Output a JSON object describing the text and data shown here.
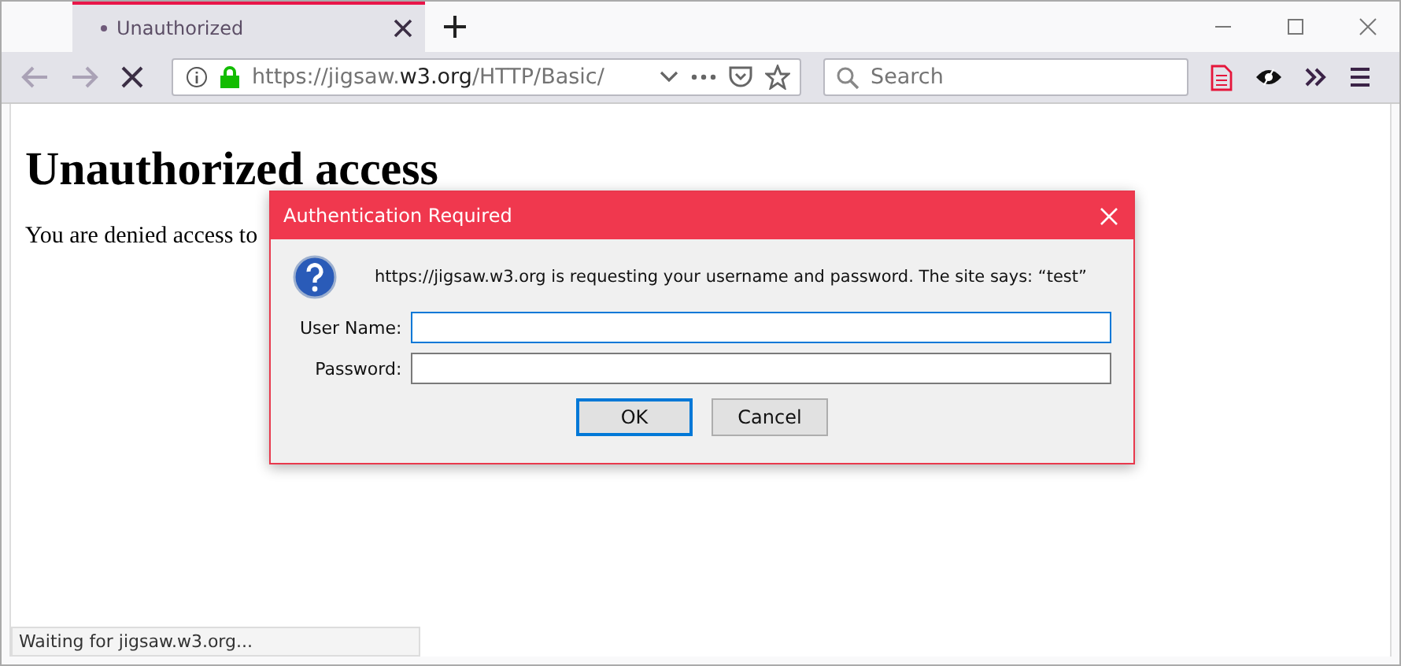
{
  "tabs": [
    {
      "title": "Unauthorized",
      "selected": true
    }
  ],
  "address_bar": {
    "url_prefix": "https://jigsaw.",
    "url_domain": "w3.org",
    "url_path": "/HTTP/Basic/"
  },
  "search": {
    "placeholder": "Search"
  },
  "page": {
    "heading": "Unauthorized access",
    "paragraph": "You are denied access to"
  },
  "dialog": {
    "title": "Authentication Required",
    "message": "https://jigsaw.w3.org is requesting your username and password. The site says: “test”",
    "fields": [
      {
        "label": "User Name:",
        "focused": true
      },
      {
        "label": "Password:",
        "focused": false
      }
    ],
    "buttons": [
      {
        "label": "OK",
        "default": true
      },
      {
        "label": "Cancel",
        "default": false
      }
    ]
  },
  "status_bar": "Waiting for jigsaw.w3.org..."
}
